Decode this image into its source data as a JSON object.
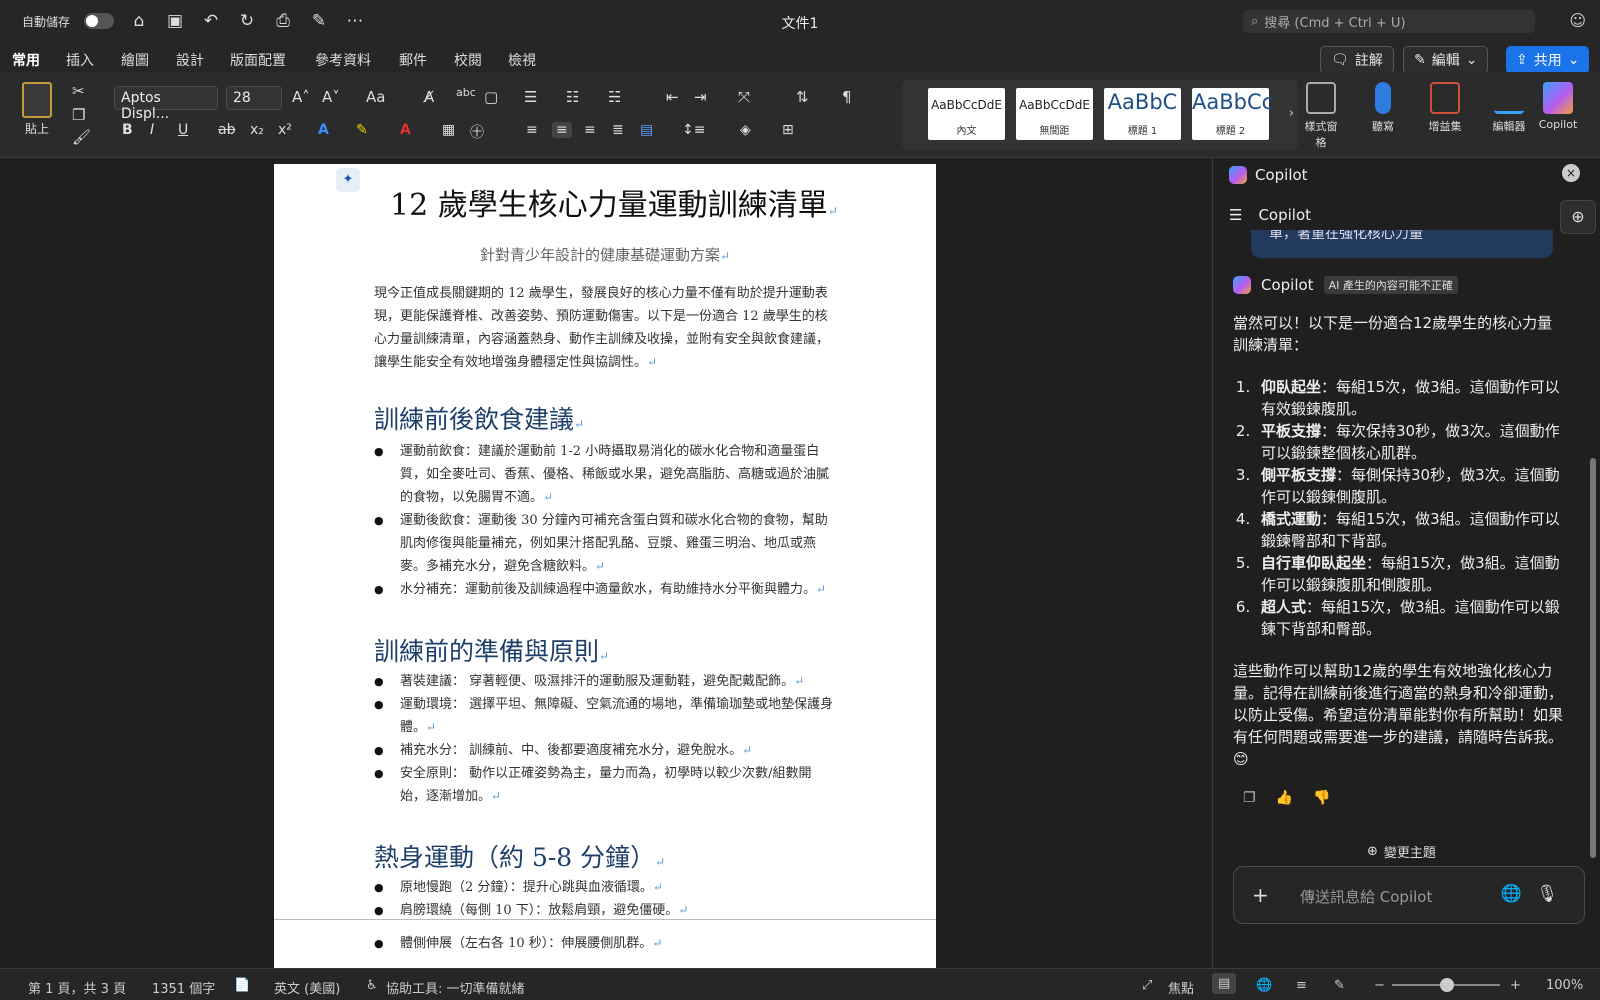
{
  "titlebar": {
    "autosave_label": "自動儲存",
    "doc_title": "文件1",
    "search_placeholder": "搜尋 (Cmd + Ctrl + U)"
  },
  "tabs": [
    "常用",
    "插入",
    "繪圖",
    "設計",
    "版面配置",
    "參考資料",
    "郵件",
    "校閱",
    "檢視"
  ],
  "actions": {
    "comment": "註解",
    "edit": "編輯",
    "share": "共用"
  },
  "ribbon": {
    "paste": "貼上",
    "font_name": "Aptos Displ...",
    "font_size": "28",
    "styles": [
      {
        "sample": "AaBbCcDdE",
        "label": "內文"
      },
      {
        "sample": "AaBbCcDdE",
        "label": "無間距"
      },
      {
        "sample": "AaBbC",
        "label": "標題 1"
      },
      {
        "sample": "AaBbCc",
        "label": "標題 2"
      }
    ],
    "style_pane": "樣式窗格",
    "dictate": "聽寫",
    "addins": "增益集",
    "editor": "編輯器",
    "copilot": "Copilot"
  },
  "document": {
    "title": "12 歲學生核心力量運動訓練清單",
    "subtitle": "針對青少年設計的健康基礎運動方案",
    "intro": "現今正值成長關鍵期的 12 歲學生，發展良好的核心力量不僅有助於提升運動表現，更能保護脊椎、改善姿勢、預防運動傷害。以下是一份適合 12 歲學生的核心力量訓練清單，內容涵蓋熱身、動作主訓練及收操，並附有安全與飲食建議，讓學生能安全有效地增強身體穩定性與協調性。",
    "sections": [
      {
        "heading": "訓練前後飲食建議",
        "items": [
          "運動前飲食：建議於運動前 1-2 小時攝取易消化的碳水化合物和適量蛋白質，如全麥吐司、香蕉、優格、稀飯或水果，避免高脂肪、高糖或過於油膩的食物，以免腸胃不適。",
          "運動後飲食：運動後 30 分鐘內可補充含蛋白質和碳水化合物的食物，幫助肌肉修復與能量補充，例如果汁搭配乳酪、豆漿、雞蛋三明治、地瓜或燕麥。多補充水分，避免含糖飲料。",
          "水分補充：運動前後及訓練過程中適量飲水，有助維持水分平衡與體力。"
        ]
      },
      {
        "heading": "訓練前的準備與原則",
        "items": [
          "著裝建議： 穿著輕便、吸濕排汗的運動服及運動鞋，避免配戴配飾。",
          "運動環境： 選擇平坦、無障礙、空氣流通的場地，準備瑜珈墊或地墊保護身體。",
          "補充水分： 訓練前、中、後都要適度補充水分，避免脫水。",
          "安全原則： 動作以正確姿勢為主，量力而為，初學時以較少次數/組數開始，逐漸增加。"
        ]
      },
      {
        "heading": "熱身運動（約 5-8 分鐘）",
        "items": [
          "原地慢跑（2 分鐘）：提升心跳與血液循環。",
          "肩膀環繞（每側 10 下）：放鬆肩頸，避免僵硬。",
          "體側伸展（左右各 10 秒）：伸展腰側肌群。"
        ]
      }
    ]
  },
  "status": {
    "page": "第 1 頁，共 3 頁",
    "words": "1351 個字",
    "language": "英文 (美國)",
    "accessibility": "協助工具: 一切準備就緒",
    "focus": "焦點",
    "zoom": "100%"
  },
  "copilot": {
    "header": "Copilot",
    "sub_header": "Copilot",
    "prev_bubble": "單，著重在強化核心力量",
    "resp_name": "Copilot",
    "ai_badge": "AI 產生的內容可能不正確",
    "intro": "當然可以！以下是一份適合12歲學生的核心力量訓練清單：",
    "items": [
      {
        "name": "仰臥起坐",
        "text": "：每組15次，做3組。這個動作可以有效鍛鍊腹肌。"
      },
      {
        "name": "平板支撐",
        "text": "：每次保持30秒，做3次。這個動作可以鍛鍊整個核心肌群。"
      },
      {
        "name": "側平板支撐",
        "text": "：每側保持30秒，做3次。這個動作可以鍛鍊側腹肌。"
      },
      {
        "name": "橋式運動",
        "text": "：每組15次，做3組。這個動作可以鍛鍊臀部和下背部。"
      },
      {
        "name": "自行車仰臥起坐",
        "text": "：每組15次，做3組。這個動作可以鍛鍊腹肌和側腹肌。"
      },
      {
        "name": "超人式",
        "text": "：每組15次，做3組。這個動作可以鍛鍊下背部和臀部。"
      }
    ],
    "outro": "這些動作可以幫助12歲的學生有效地強化核心力量。記得在訓練前後進行適當的熱身和冷卻運動，以防止受傷。希望這份清單能對你有所幫助！如果有任何問題或需要進一步的建議，請隨時告訴我。😊",
    "change_topic": "變更主題",
    "input_placeholder": "傳送訊息給 Copilot"
  }
}
